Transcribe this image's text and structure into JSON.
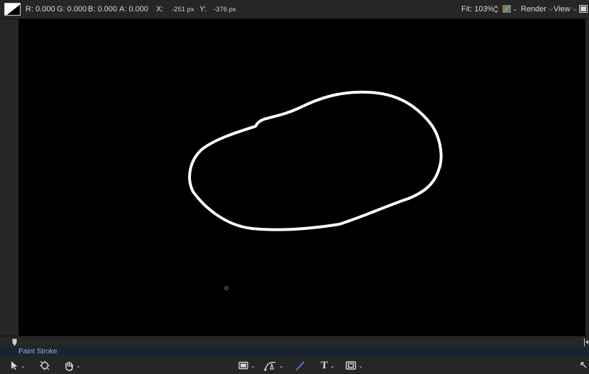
{
  "info_bar": {
    "r": "R: 0.000",
    "g": "G: 0.000",
    "b": "B: 0.000",
    "a": "A: 0.000",
    "x_label": "X:",
    "x_value": "-251 px",
    "y_label": "Y:",
    "y_value": "-376 px",
    "fit": "Fit: 103%",
    "render": "Render",
    "view": "View"
  },
  "layer": {
    "name": "Paint Stroke"
  },
  "colors": {
    "canvas": "#000000",
    "stroke": "#ffffff",
    "layer_bar": "#1c2434",
    "paint_tool_accent": "#5b6ee0"
  },
  "icons": {
    "color_swatch": "color-swatch-icon",
    "channels": "color-channels-icon",
    "panel_toggle": "panel-toggle-icon",
    "select": "arrow-select-icon",
    "transform": "transform-anchor-icon",
    "hand": "hand-pan-icon",
    "shape": "rectangle-shape-icon",
    "bezier": "bezier-pen-icon",
    "paint": "paint-stroke-icon",
    "text": "text-tool-icon",
    "mask": "mask-rect-icon",
    "fullscreen": "fullscreen-arrow-icon"
  }
}
